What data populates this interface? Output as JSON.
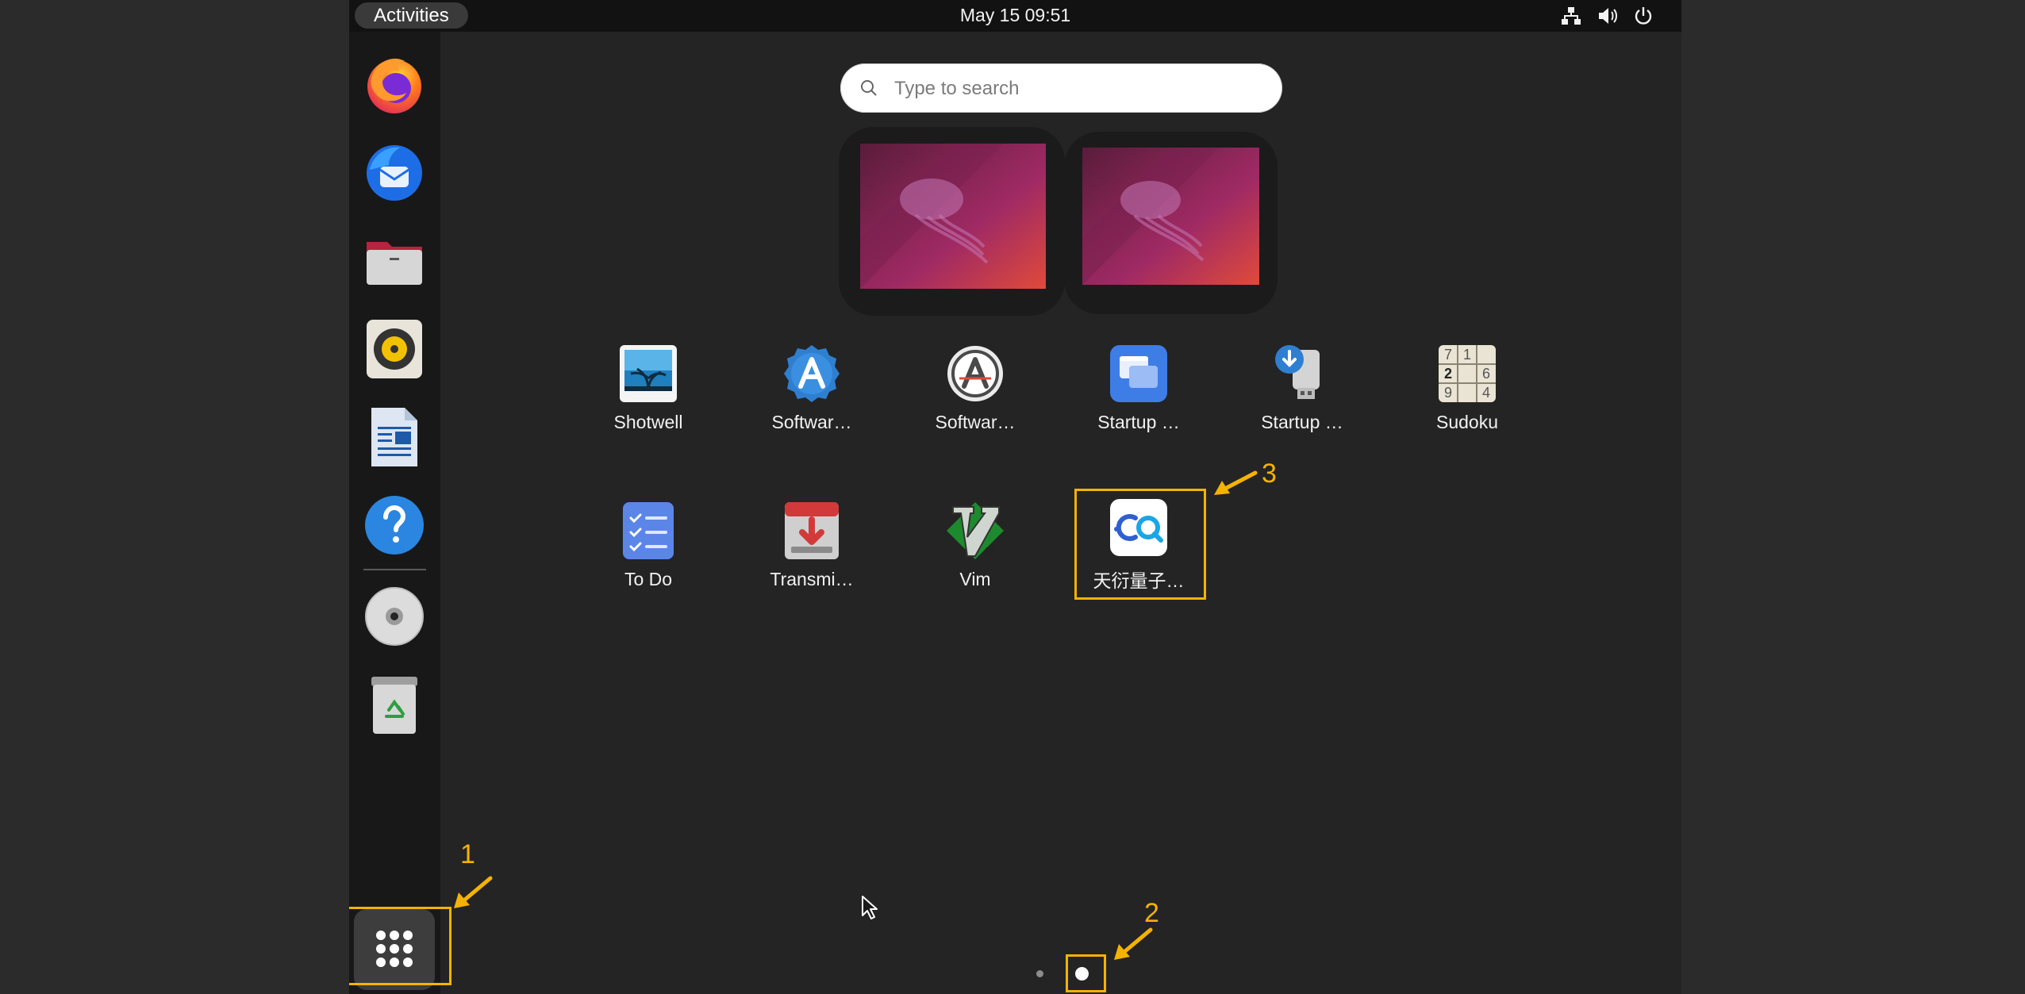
{
  "topbar": {
    "activities_label": "Activities",
    "datetime": "May 15  09:51",
    "indicators": [
      "network-icon",
      "volume-icon",
      "power-icon"
    ]
  },
  "dock": {
    "items": [
      {
        "name": "Firefox",
        "icon": "firefox-icon"
      },
      {
        "name": "Thunderbird",
        "icon": "thunderbird-icon"
      },
      {
        "name": "Files",
        "icon": "files-icon"
      },
      {
        "name": "Rhythmbox",
        "icon": "rhythmbox-icon"
      },
      {
        "name": "LibreOffice Writer",
        "icon": "writer-icon"
      },
      {
        "name": "Help",
        "icon": "help-icon"
      },
      {
        "name": "Disc",
        "icon": "disc-icon"
      },
      {
        "name": "Trash",
        "icon": "trash-icon"
      }
    ],
    "show_apps_icon": "grid-icon"
  },
  "search": {
    "placeholder": "Type to search",
    "value": ""
  },
  "apps": [
    {
      "label": "Shotwell",
      "icon": "shotwell-icon"
    },
    {
      "label": "Softwar…",
      "icon": "software-icon"
    },
    {
      "label": "Softwar…",
      "icon": "software-updater-icon"
    },
    {
      "label": "Startup …",
      "icon": "startup-applications-icon"
    },
    {
      "label": "Startup …",
      "icon": "startup-disk-creator-icon"
    },
    {
      "label": "Sudoku",
      "icon": "sudoku-icon"
    },
    {
      "label": "To Do",
      "icon": "todo-icon"
    },
    {
      "label": "Transmi…",
      "icon": "transmission-icon"
    },
    {
      "label": "Vim",
      "icon": "vim-icon"
    },
    {
      "label": "天衍量子…",
      "icon": "tianyan-quantum-icon"
    }
  ],
  "sudoku_digits": [
    "7",
    "1",
    "2",
    "6",
    "9",
    "4"
  ],
  "pagination": {
    "pages": 2,
    "current": 2
  },
  "annotations": [
    "1",
    "2",
    "3"
  ],
  "colors": {
    "accent_highlight": "#f5b301",
    "background": "#242424",
    "topbar": "#121212",
    "dock": "#181818"
  }
}
